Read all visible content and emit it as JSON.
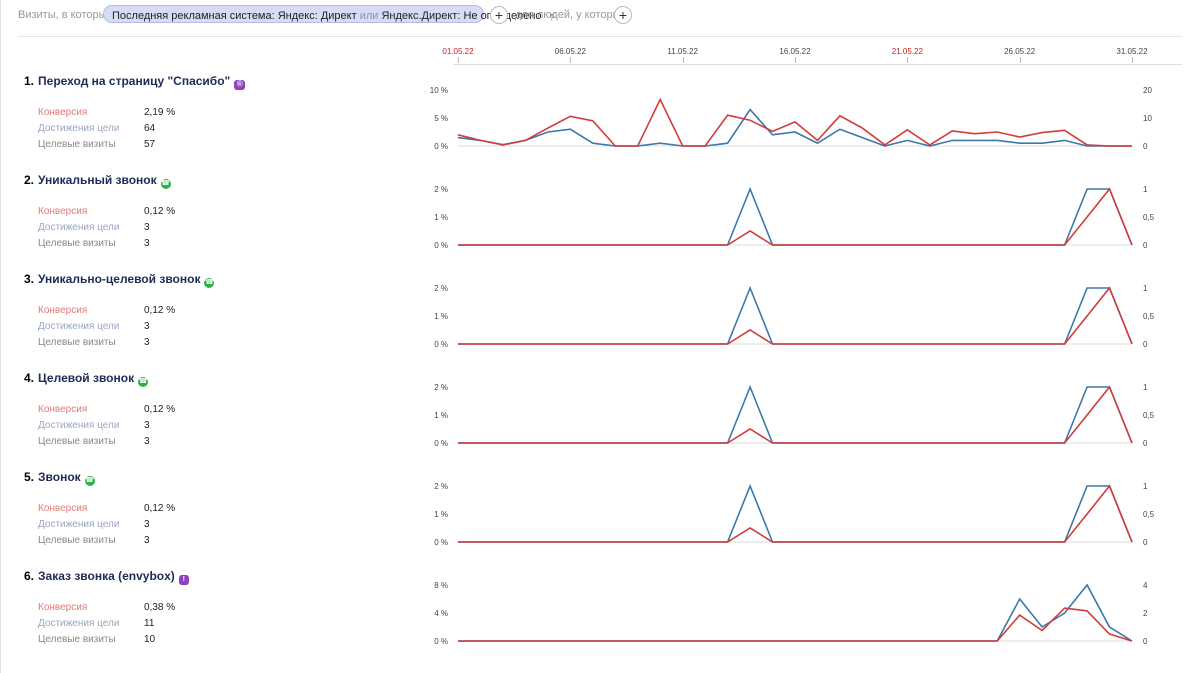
{
  "filter": {
    "visits_label": "Визиты, в которых",
    "chip": {
      "prefix": "Последняя рекламная система: Яндекс: Директ",
      "or_word": "или",
      "suffix": "Яндекс.Директ: Не определено",
      "close": "×"
    },
    "plus_symbol": "+",
    "people_label": "для людей, у которых"
  },
  "date_axis": {
    "labels": [
      {
        "text": "01.05.22",
        "day": 0,
        "weekend": true
      },
      {
        "text": "06.05.22",
        "day": 5,
        "weekend": false
      },
      {
        "text": "11.05.22",
        "day": 10,
        "weekend": false
      },
      {
        "text": "16.05.22",
        "day": 15,
        "weekend": false
      },
      {
        "text": "21.05.22",
        "day": 20,
        "weekend": true
      },
      {
        "text": "26.05.22",
        "day": 25,
        "weekend": false
      },
      {
        "text": "31.05.22",
        "day": 30,
        "weekend": false
      }
    ]
  },
  "stat_labels": {
    "conversion": "Конверсия",
    "achievements": "Достижения цели",
    "visits": "Целевые визиты"
  },
  "colors": {
    "conversion_line": "#d23b3b",
    "count_line": "#3d78a8"
  },
  "goals": [
    {
      "number": "1.",
      "title": "Переход на страницу \"Спасибо\"",
      "icon": "goal-tag-icon",
      "conversion": "2,19 %",
      "achievements": "64",
      "visits": "57"
    },
    {
      "number": "2.",
      "title": "Уникальный звонок",
      "icon": "phone-icon",
      "conversion": "0,12 %",
      "achievements": "3",
      "visits": "3"
    },
    {
      "number": "3.",
      "title": "Уникально-целевой звонок",
      "icon": "phone-icon",
      "conversion": "0,12 %",
      "achievements": "3",
      "visits": "3"
    },
    {
      "number": "4.",
      "title": "Целевой звонок",
      "icon": "phone-icon",
      "conversion": "0,12 %",
      "achievements": "3",
      "visits": "3"
    },
    {
      "number": "5.",
      "title": "Звонок",
      "icon": "phone-icon",
      "conversion": "0,12 %",
      "achievements": "3",
      "visits": "3"
    },
    {
      "number": "6.",
      "title": "Заказ звонка (envybox)",
      "icon": "form-icon",
      "conversion": "0,38 %",
      "achievements": "11",
      "visits": "10"
    }
  ],
  "chart_data": [
    {
      "type": "line",
      "x": [
        "01.05.22",
        "02.05.22",
        "03.05.22",
        "04.05.22",
        "05.05.22",
        "06.05.22",
        "07.05.22",
        "08.05.22",
        "09.05.22",
        "10.05.22",
        "11.05.22",
        "12.05.22",
        "13.05.22",
        "14.05.22",
        "15.05.22",
        "16.05.22",
        "17.05.22",
        "18.05.22",
        "19.05.22",
        "20.05.22",
        "21.05.22",
        "22.05.22",
        "23.05.22",
        "24.05.22",
        "25.05.22",
        "26.05.22",
        "27.05.22",
        "28.05.22",
        "29.05.22",
        "30.05.22",
        "31.05.22"
      ],
      "left_axis": {
        "ticks": [
          "10 %",
          "5 %",
          "0 %"
        ],
        "max": 10
      },
      "right_axis": {
        "ticks": [
          "20",
          "10",
          "0"
        ],
        "max": 20
      },
      "series": [
        {
          "axis": "left",
          "values": [
            2.0,
            1.0,
            0.2,
            1.0,
            3.2,
            5.3,
            4.5,
            0,
            0,
            8.3,
            0,
            0,
            5.5,
            4.6,
            2.6,
            4.3,
            1.0,
            5.4,
            3.2,
            0.2,
            2.9,
            0.2,
            2.7,
            2.2,
            2.5,
            1.6,
            2.4,
            2.8,
            0.2,
            0,
            0
          ]
        },
        {
          "axis": "right",
          "values": [
            3,
            2,
            0.5,
            2,
            5,
            6,
            1,
            0,
            0,
            1,
            0,
            0,
            1,
            13,
            4,
            5,
            1,
            6,
            3,
            0,
            2,
            0,
            2,
            2,
            2,
            1,
            1,
            2,
            0,
            0,
            0
          ]
        }
      ]
    },
    {
      "type": "line",
      "x": [
        "01.05.22",
        "02.05.22",
        "03.05.22",
        "04.05.22",
        "05.05.22",
        "06.05.22",
        "07.05.22",
        "08.05.22",
        "09.05.22",
        "10.05.22",
        "11.05.22",
        "12.05.22",
        "13.05.22",
        "14.05.22",
        "15.05.22",
        "16.05.22",
        "17.05.22",
        "18.05.22",
        "19.05.22",
        "20.05.22",
        "21.05.22",
        "22.05.22",
        "23.05.22",
        "24.05.22",
        "25.05.22",
        "26.05.22",
        "27.05.22",
        "28.05.22",
        "29.05.22",
        "30.05.22",
        "31.05.22"
      ],
      "left_axis": {
        "ticks": [
          "2 %",
          "1 %",
          "0 %"
        ],
        "max": 2
      },
      "right_axis": {
        "ticks": [
          "1",
          "0,5",
          "0"
        ],
        "max": 1
      },
      "series": [
        {
          "axis": "left",
          "values": [
            0,
            0,
            0,
            0,
            0,
            0,
            0,
            0,
            0,
            0,
            0,
            0,
            0,
            0.5,
            0,
            0,
            0,
            0,
            0,
            0,
            0,
            0,
            0,
            0,
            0,
            0,
            0,
            0,
            1.0,
            2.0,
            0
          ]
        },
        {
          "axis": "right",
          "values": [
            0,
            0,
            0,
            0,
            0,
            0,
            0,
            0,
            0,
            0,
            0,
            0,
            0,
            1,
            0,
            0,
            0,
            0,
            0,
            0,
            0,
            0,
            0,
            0,
            0,
            0,
            0,
            0,
            1,
            1,
            0
          ]
        }
      ]
    },
    {
      "type": "line",
      "x": [
        "01.05.22",
        "02.05.22",
        "03.05.22",
        "04.05.22",
        "05.05.22",
        "06.05.22",
        "07.05.22",
        "08.05.22",
        "09.05.22",
        "10.05.22",
        "11.05.22",
        "12.05.22",
        "13.05.22",
        "14.05.22",
        "15.05.22",
        "16.05.22",
        "17.05.22",
        "18.05.22",
        "19.05.22",
        "20.05.22",
        "21.05.22",
        "22.05.22",
        "23.05.22",
        "24.05.22",
        "25.05.22",
        "26.05.22",
        "27.05.22",
        "28.05.22",
        "29.05.22",
        "30.05.22",
        "31.05.22"
      ],
      "left_axis": {
        "ticks": [
          "2 %",
          "1 %",
          "0 %"
        ],
        "max": 2
      },
      "right_axis": {
        "ticks": [
          "1",
          "0,5",
          "0"
        ],
        "max": 1
      },
      "series": [
        {
          "axis": "left",
          "values": [
            0,
            0,
            0,
            0,
            0,
            0,
            0,
            0,
            0,
            0,
            0,
            0,
            0,
            0.5,
            0,
            0,
            0,
            0,
            0,
            0,
            0,
            0,
            0,
            0,
            0,
            0,
            0,
            0,
            1.0,
            2.0,
            0
          ]
        },
        {
          "axis": "right",
          "values": [
            0,
            0,
            0,
            0,
            0,
            0,
            0,
            0,
            0,
            0,
            0,
            0,
            0,
            1,
            0,
            0,
            0,
            0,
            0,
            0,
            0,
            0,
            0,
            0,
            0,
            0,
            0,
            0,
            1,
            1,
            0
          ]
        }
      ]
    },
    {
      "type": "line",
      "x": [
        "01.05.22",
        "02.05.22",
        "03.05.22",
        "04.05.22",
        "05.05.22",
        "06.05.22",
        "07.05.22",
        "08.05.22",
        "09.05.22",
        "10.05.22",
        "11.05.22",
        "12.05.22",
        "13.05.22",
        "14.05.22",
        "15.05.22",
        "16.05.22",
        "17.05.22",
        "18.05.22",
        "19.05.22",
        "20.05.22",
        "21.05.22",
        "22.05.22",
        "23.05.22",
        "24.05.22",
        "25.05.22",
        "26.05.22",
        "27.05.22",
        "28.05.22",
        "29.05.22",
        "30.05.22",
        "31.05.22"
      ],
      "left_axis": {
        "ticks": [
          "2 %",
          "1 %",
          "0 %"
        ],
        "max": 2
      },
      "right_axis": {
        "ticks": [
          "1",
          "0,5",
          "0"
        ],
        "max": 1
      },
      "series": [
        {
          "axis": "left",
          "values": [
            0,
            0,
            0,
            0,
            0,
            0,
            0,
            0,
            0,
            0,
            0,
            0,
            0,
            0.5,
            0,
            0,
            0,
            0,
            0,
            0,
            0,
            0,
            0,
            0,
            0,
            0,
            0,
            0,
            1.0,
            2.0,
            0
          ]
        },
        {
          "axis": "right",
          "values": [
            0,
            0,
            0,
            0,
            0,
            0,
            0,
            0,
            0,
            0,
            0,
            0,
            0,
            1,
            0,
            0,
            0,
            0,
            0,
            0,
            0,
            0,
            0,
            0,
            0,
            0,
            0,
            0,
            1,
            1,
            0
          ]
        }
      ]
    },
    {
      "type": "line",
      "x": [
        "01.05.22",
        "02.05.22",
        "03.05.22",
        "04.05.22",
        "05.05.22",
        "06.05.22",
        "07.05.22",
        "08.05.22",
        "09.05.22",
        "10.05.22",
        "11.05.22",
        "12.05.22",
        "13.05.22",
        "14.05.22",
        "15.05.22",
        "16.05.22",
        "17.05.22",
        "18.05.22",
        "19.05.22",
        "20.05.22",
        "21.05.22",
        "22.05.22",
        "23.05.22",
        "24.05.22",
        "25.05.22",
        "26.05.22",
        "27.05.22",
        "28.05.22",
        "29.05.22",
        "30.05.22",
        "31.05.22"
      ],
      "left_axis": {
        "ticks": [
          "2 %",
          "1 %",
          "0 %"
        ],
        "max": 2
      },
      "right_axis": {
        "ticks": [
          "1",
          "0,5",
          "0"
        ],
        "max": 1
      },
      "series": [
        {
          "axis": "left",
          "values": [
            0,
            0,
            0,
            0,
            0,
            0,
            0,
            0,
            0,
            0,
            0,
            0,
            0,
            0.5,
            0,
            0,
            0,
            0,
            0,
            0,
            0,
            0,
            0,
            0,
            0,
            0,
            0,
            0,
            1.0,
            2.0,
            0
          ]
        },
        {
          "axis": "right",
          "values": [
            0,
            0,
            0,
            0,
            0,
            0,
            0,
            0,
            0,
            0,
            0,
            0,
            0,
            1,
            0,
            0,
            0,
            0,
            0,
            0,
            0,
            0,
            0,
            0,
            0,
            0,
            0,
            0,
            1,
            1,
            0
          ]
        }
      ]
    },
    {
      "type": "line",
      "x": [
        "01.05.22",
        "02.05.22",
        "03.05.22",
        "04.05.22",
        "05.05.22",
        "06.05.22",
        "07.05.22",
        "08.05.22",
        "09.05.22",
        "10.05.22",
        "11.05.22",
        "12.05.22",
        "13.05.22",
        "14.05.22",
        "15.05.22",
        "16.05.22",
        "17.05.22",
        "18.05.22",
        "19.05.22",
        "20.05.22",
        "21.05.22",
        "22.05.22",
        "23.05.22",
        "24.05.22",
        "25.05.22",
        "26.05.22",
        "27.05.22",
        "28.05.22",
        "29.05.22",
        "30.05.22",
        "31.05.22"
      ],
      "left_axis": {
        "ticks": [
          "8 %",
          "4 %",
          "0 %"
        ],
        "max": 8
      },
      "right_axis": {
        "ticks": [
          "4",
          "2",
          "0"
        ],
        "max": 4
      },
      "series": [
        {
          "axis": "left",
          "values": [
            0,
            0,
            0,
            0,
            0,
            0,
            0,
            0,
            0,
            0,
            0,
            0,
            0,
            0,
            0,
            0,
            0,
            0,
            0,
            0,
            0,
            0,
            0,
            0,
            0,
            3.7,
            1.5,
            4.7,
            4.3,
            1.0,
            0
          ]
        },
        {
          "axis": "right",
          "values": [
            0,
            0,
            0,
            0,
            0,
            0,
            0,
            0,
            0,
            0,
            0,
            0,
            0,
            0,
            0,
            0,
            0,
            0,
            0,
            0,
            0,
            0,
            0,
            0,
            0,
            3,
            1,
            2,
            4,
            1,
            0
          ]
        }
      ]
    }
  ]
}
